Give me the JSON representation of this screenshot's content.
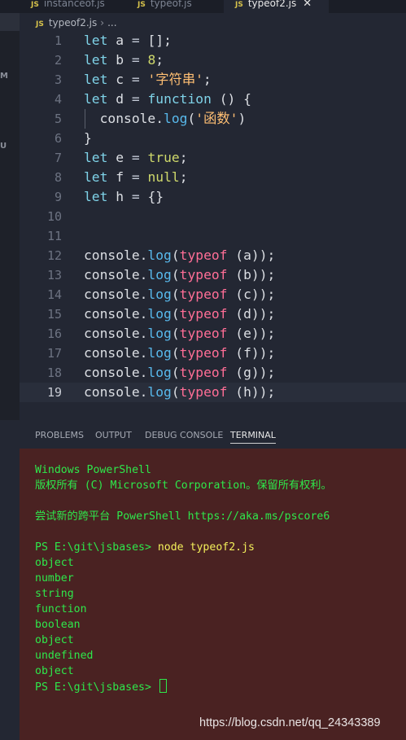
{
  "tabs": [
    {
      "label": "instanceof.js",
      "active": false
    },
    {
      "label": "typeof.js",
      "active": false
    },
    {
      "label": "typeof2.js",
      "active": true
    }
  ],
  "tab_icon_text": "JS",
  "breadcrumb": {
    "icon_text": "JS",
    "file": "typeof2.js",
    "separator": "›",
    "rest": "..."
  },
  "activity_letters": [
    "M",
    "U"
  ],
  "editor": {
    "lines": [
      {
        "n": "1",
        "html": "<span class=\"kw\">let</span> a <span class=\"op\">=</span> [];"
      },
      {
        "n": "2",
        "html": "<span class=\"kw\">let</span> b <span class=\"op\">=</span> <span class=\"num\">8</span>;"
      },
      {
        "n": "3",
        "html": "<span class=\"kw\">let</span> c <span class=\"op\">=</span> <span class=\"str\">'字符串'</span>;"
      },
      {
        "n": "4",
        "html": "<span class=\"kw\">let</span> d <span class=\"op\">=</span> <span class=\"kwf\">function</span> () {"
      },
      {
        "n": "5",
        "indent": true,
        "html": "  console.<span class=\"fn\">log</span>(<span class=\"str\">'函数'</span>)"
      },
      {
        "n": "6",
        "html": "}"
      },
      {
        "n": "7",
        "html": "<span class=\"kw\">let</span> e <span class=\"op\">=</span> <span class=\"lit\">true</span>;"
      },
      {
        "n": "8",
        "html": "<span class=\"kw\">let</span> f <span class=\"op\">=</span> <span class=\"lit\">null</span>;"
      },
      {
        "n": "9",
        "html": "<span class=\"kw\">let</span> h <span class=\"op\">=</span> {}"
      },
      {
        "n": "10",
        "html": ""
      },
      {
        "n": "11",
        "html": ""
      },
      {
        "n": "12",
        "html": "console.<span class=\"fn\">log</span>(<span class=\"ty\">typeof</span> (a));"
      },
      {
        "n": "13",
        "html": "console.<span class=\"fn\">log</span>(<span class=\"ty\">typeof</span> (b));"
      },
      {
        "n": "14",
        "html": "console.<span class=\"fn\">log</span>(<span class=\"ty\">typeof</span> (c));"
      },
      {
        "n": "15",
        "html": "console.<span class=\"fn\">log</span>(<span class=\"ty\">typeof</span> (d));"
      },
      {
        "n": "16",
        "html": "console.<span class=\"fn\">log</span>(<span class=\"ty\">typeof</span> (e));"
      },
      {
        "n": "17",
        "html": "console.<span class=\"fn\">log</span>(<span class=\"ty\">typeof</span> (f));"
      },
      {
        "n": "18",
        "html": "console.<span class=\"fn\">log</span>(<span class=\"ty\">typeof</span> (g));"
      },
      {
        "n": "19",
        "current": true,
        "html": "console.<span class=\"fn\">log</span>(<span class=\"ty\">typeof</span> (h));"
      }
    ]
  },
  "panel": {
    "tabs": [
      {
        "label": "PROBLEMS",
        "active": false
      },
      {
        "label": "OUTPUT",
        "active": false
      },
      {
        "label": "DEBUG CONSOLE",
        "active": false
      },
      {
        "label": "TERMINAL",
        "active": true
      }
    ]
  },
  "terminal": {
    "lines": [
      "Windows PowerShell",
      "版权所有 (C) Microsoft Corporation。保留所有权利。",
      "",
      "尝试新的跨平台 PowerShell https://aka.ms/pscore6",
      "",
      "PS E:\\git\\jsbases> node typeof2.js",
      "object",
      "number",
      "string",
      "function",
      "boolean",
      "object",
      "undefined",
      "object",
      "PS E:\\git\\jsbases> "
    ],
    "prompt": "PS E:\\git\\jsbases> ",
    "command": "node typeof2.js"
  },
  "watermark": "https://blog.csdn.net/qq_24343389"
}
